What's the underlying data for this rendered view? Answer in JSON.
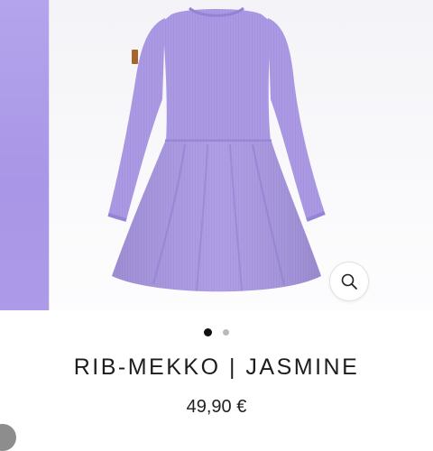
{
  "gallery": {
    "previous_slide_color": "#aa98e7",
    "image_alt": "Purple ribbed long-sleeve dress",
    "dress_color": "#a996e2",
    "zoom_icon": "magnifier-icon",
    "slide_count": 2,
    "active_slide": 1
  },
  "product": {
    "title": "RIB-MEKKO | JASMINE",
    "price": "49,90 €"
  }
}
